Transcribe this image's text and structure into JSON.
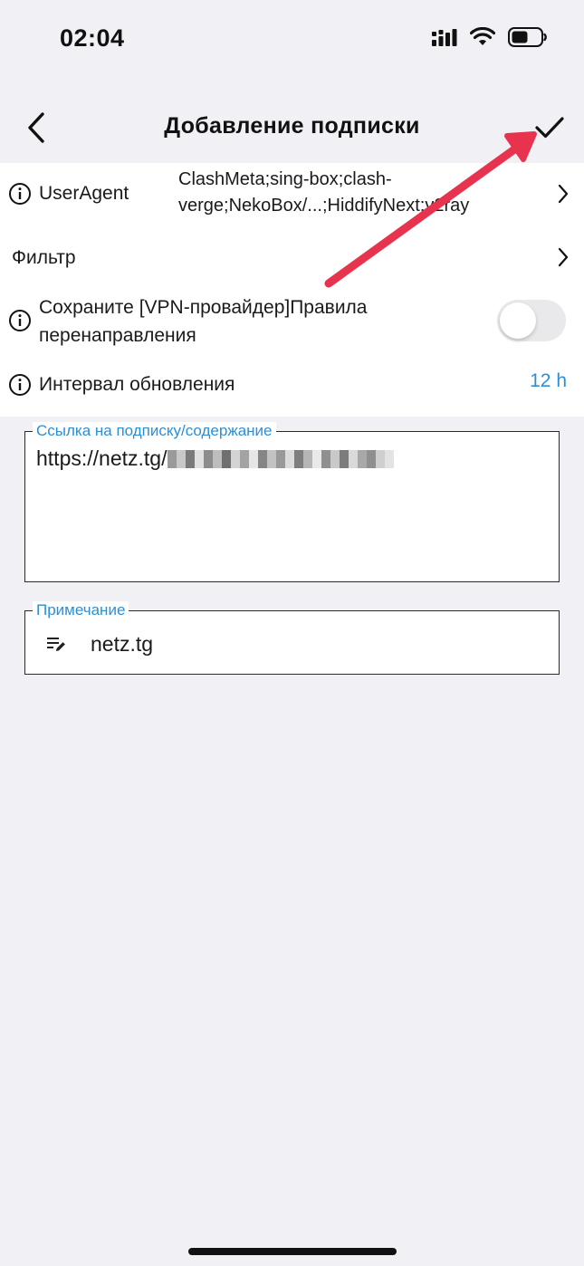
{
  "status_bar": {
    "time": "02:04"
  },
  "nav": {
    "title": "Добавление подписки",
    "back_icon": "chevron-left-icon",
    "confirm_icon": "checkmark-icon"
  },
  "settings": {
    "user_agent": {
      "label": "UserAgent",
      "value": "ClashMeta;sing-box;clash-verge;NekoBox/...;HiddifyNext;v2ray"
    },
    "filter": {
      "label": "Фильтр"
    },
    "preserve_rules": {
      "label": "Сохраните [VPN-провайдер]Правила перенаправления",
      "enabled": false
    },
    "update_interval": {
      "label": "Интервал обновления",
      "value": "12 h"
    }
  },
  "subscription_field": {
    "legend": "Ссылка на подписку/содержание",
    "value": "https://netz.tg/"
  },
  "note_field": {
    "legend": "Примечание",
    "value": "netz.tg"
  },
  "colors": {
    "accent": "#2b8fd6",
    "annotation_arrow": "#e8334f",
    "background": "#f1f1f5",
    "panel": "#ffffff"
  }
}
